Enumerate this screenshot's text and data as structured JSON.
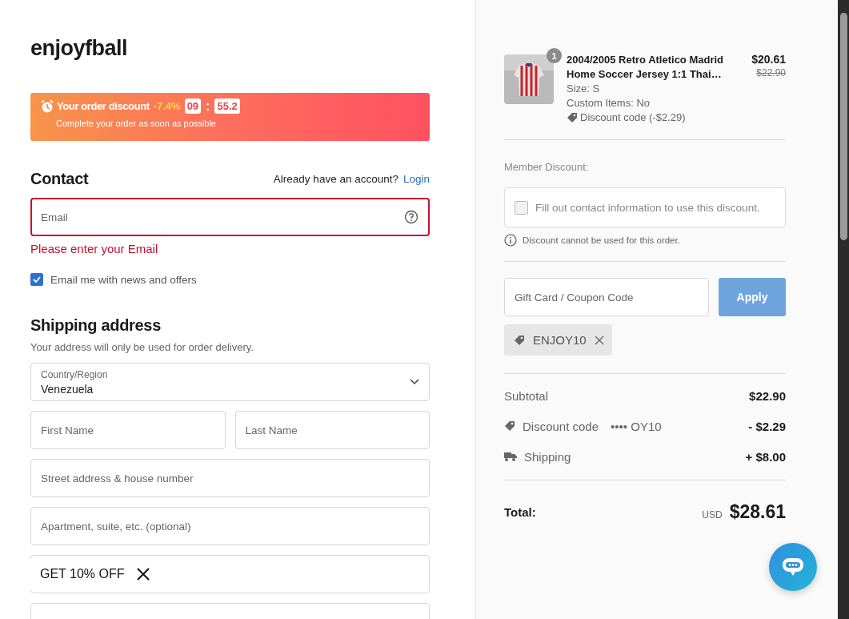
{
  "brand": "enjoyfball",
  "discount_banner": {
    "title": "Your order discount",
    "percent": "-7.4%",
    "minutes": "09",
    "separator": ":",
    "seconds": "55.2",
    "subtitle": "Complete your order as soon as possible"
  },
  "contact": {
    "heading": "Contact",
    "account_prompt": "Already have an account?",
    "login_link": "Login",
    "email": {
      "placeholder": "Email",
      "invalid": true
    },
    "error": "Please enter your Email",
    "newsletter": {
      "label": "Email me with news and offers",
      "checked": true
    }
  },
  "shipping": {
    "heading": "Shipping address",
    "note": "Your address will only be used for order delivery.",
    "fields": [
      {
        "kind": "select",
        "label": "Country/Region",
        "value": "Venezuela"
      },
      {
        "kind": "pair",
        "children": [
          {
            "placeholder": "First Name"
          },
          {
            "placeholder": "Last Name"
          }
        ]
      },
      {
        "kind": "text",
        "placeholder": "Street address & house number"
      },
      {
        "kind": "text",
        "placeholder": "Apartment, suite, etc. (optional)"
      },
      {
        "kind": "text"
      },
      {
        "kind": "text"
      }
    ]
  },
  "promo_popup": {
    "label": "GET 10% OFF"
  },
  "summary": {
    "item": {
      "quantity": "1",
      "title": "2004/2005 Retro Atletico Madrid Home Soccer Jersey 1:1 Thai…",
      "price": "$20.61",
      "original_price": "$22.90",
      "details": [
        "Size: S",
        "Custom Items: No"
      ],
      "discount": "Discount code (-$2.29)"
    },
    "member_discount": {
      "label": "Member Discount:",
      "option": "Fill out contact information to use this discount.",
      "checked": false,
      "note": "Discount cannot be used for this order."
    },
    "coupon": {
      "placeholder": "Gift Card / Coupon Code",
      "button": "Apply",
      "applied": "ENJOY10"
    },
    "lines": [
      {
        "kind": "plain",
        "label": "Subtotal",
        "value": "$22.90"
      },
      {
        "kind": "discount",
        "label": "Discount code",
        "code": "•••• OY10",
        "value": "- $2.29"
      },
      {
        "kind": "shipping",
        "label": "Shipping",
        "value": "+ $8.00"
      }
    ],
    "total": {
      "label": "Total:",
      "currency": "USD",
      "value": "$28.61"
    }
  }
}
